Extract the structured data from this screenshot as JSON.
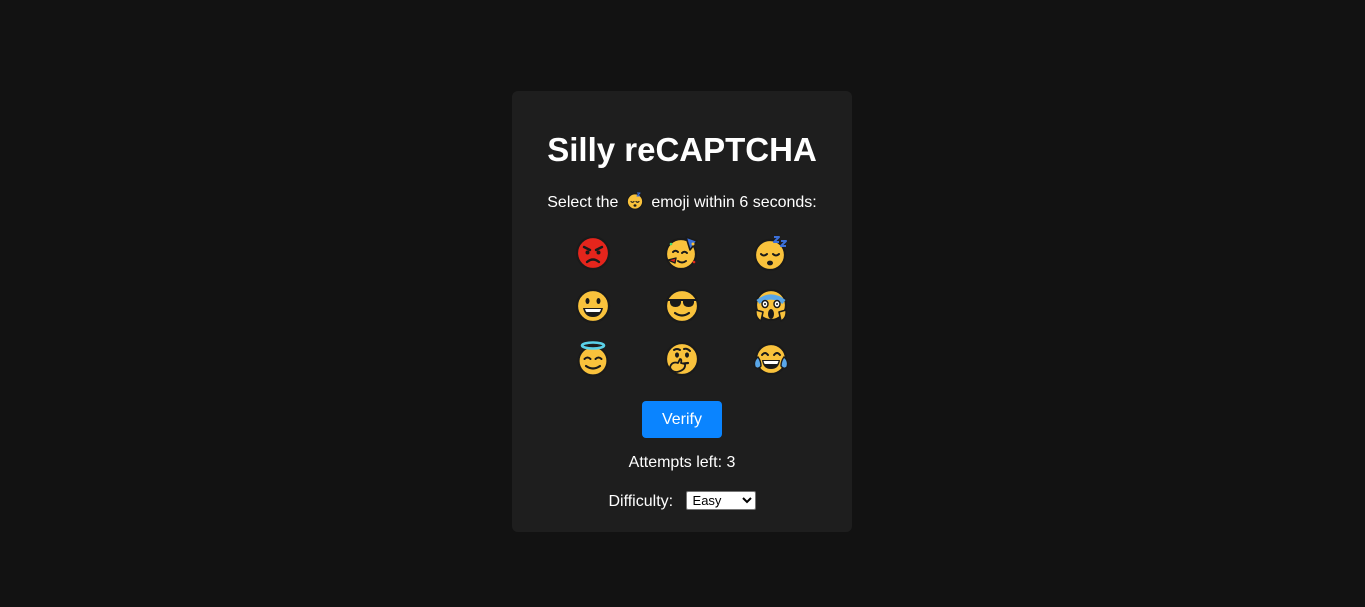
{
  "captcha": {
    "title": "Silly reCAPTCHA",
    "instruction_prefix": "Select the",
    "instruction_suffix": "emoji within 6 seconds:",
    "target_emoji": "sleeping-face",
    "grid": [
      {
        "emoji": "pouting-face"
      },
      {
        "emoji": "partying-face"
      },
      {
        "emoji": "sleeping-face"
      },
      {
        "emoji": "grinning-face"
      },
      {
        "emoji": "smiling-face-with-sunglasses"
      },
      {
        "emoji": "face-screaming-in-fear"
      },
      {
        "emoji": "smiling-face-with-halo"
      },
      {
        "emoji": "thinking-face"
      },
      {
        "emoji": "face-with-tears-of-joy"
      }
    ],
    "verify_label": "Verify",
    "attempts_label": "Attempts left: 3",
    "difficulty_label": "Difficulty:",
    "difficulty_selected": "Easy"
  },
  "colors": {
    "page_background": "#121212",
    "card_background": "#1e1e1e",
    "verify_button": "#0a84ff",
    "text": "#ffffff",
    "emoji_yellow": "#f9c23c",
    "emoji_red": "#e5251c"
  }
}
